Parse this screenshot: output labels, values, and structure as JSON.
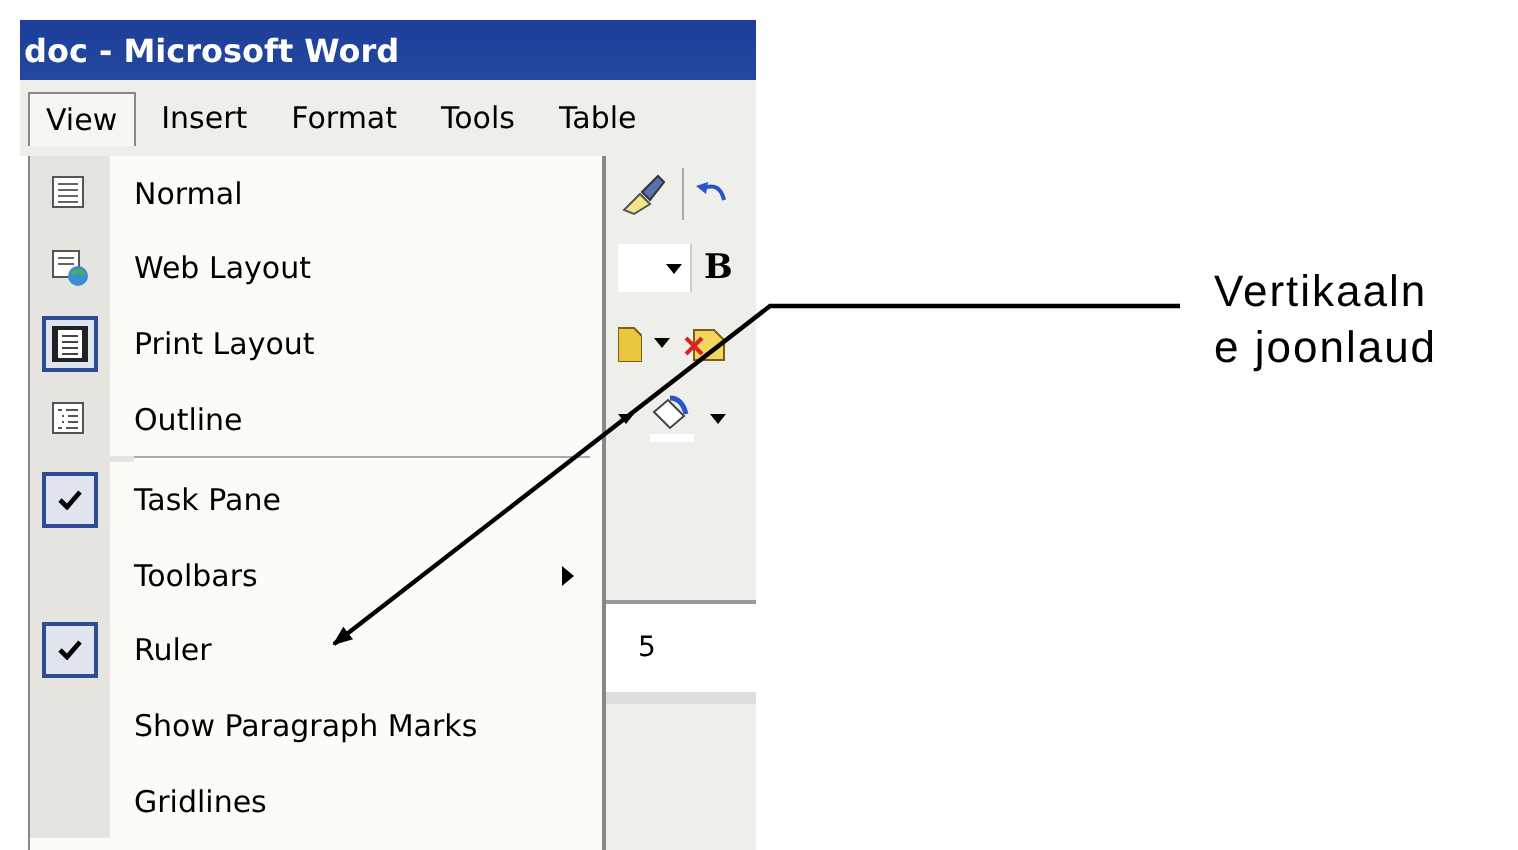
{
  "window": {
    "title": "doc - Microsoft Word"
  },
  "menu_bar": [
    {
      "label": "View",
      "selected": true
    },
    {
      "label": "Insert",
      "selected": false
    },
    {
      "label": "Format",
      "selected": false
    },
    {
      "label": "Tools",
      "selected": false
    },
    {
      "label": "Table",
      "selected": false
    }
  ],
  "view_menu": [
    {
      "kind": "view",
      "label": "Normal",
      "selected": false
    },
    {
      "kind": "view",
      "label": "Web Layout",
      "selected": false
    },
    {
      "kind": "view",
      "label": "Print Layout",
      "selected": true
    },
    {
      "kind": "view",
      "label": "Outline",
      "selected": false
    },
    {
      "kind": "separator"
    },
    {
      "kind": "toggle",
      "label": "Task Pane",
      "checked": true
    },
    {
      "kind": "submenu",
      "label": "Toolbars"
    },
    {
      "kind": "toggle",
      "label": "Ruler",
      "checked": true
    },
    {
      "kind": "toggle",
      "label": "Show Paragraph Marks",
      "checked": false
    },
    {
      "kind": "toggle",
      "label": "Gridlines",
      "checked": false
    }
  ],
  "toolbar": {
    "bold_button": "B",
    "ruler_number": "5"
  },
  "annotation": {
    "lines": [
      "Vertikaaln",
      "e joonlaud"
    ]
  }
}
